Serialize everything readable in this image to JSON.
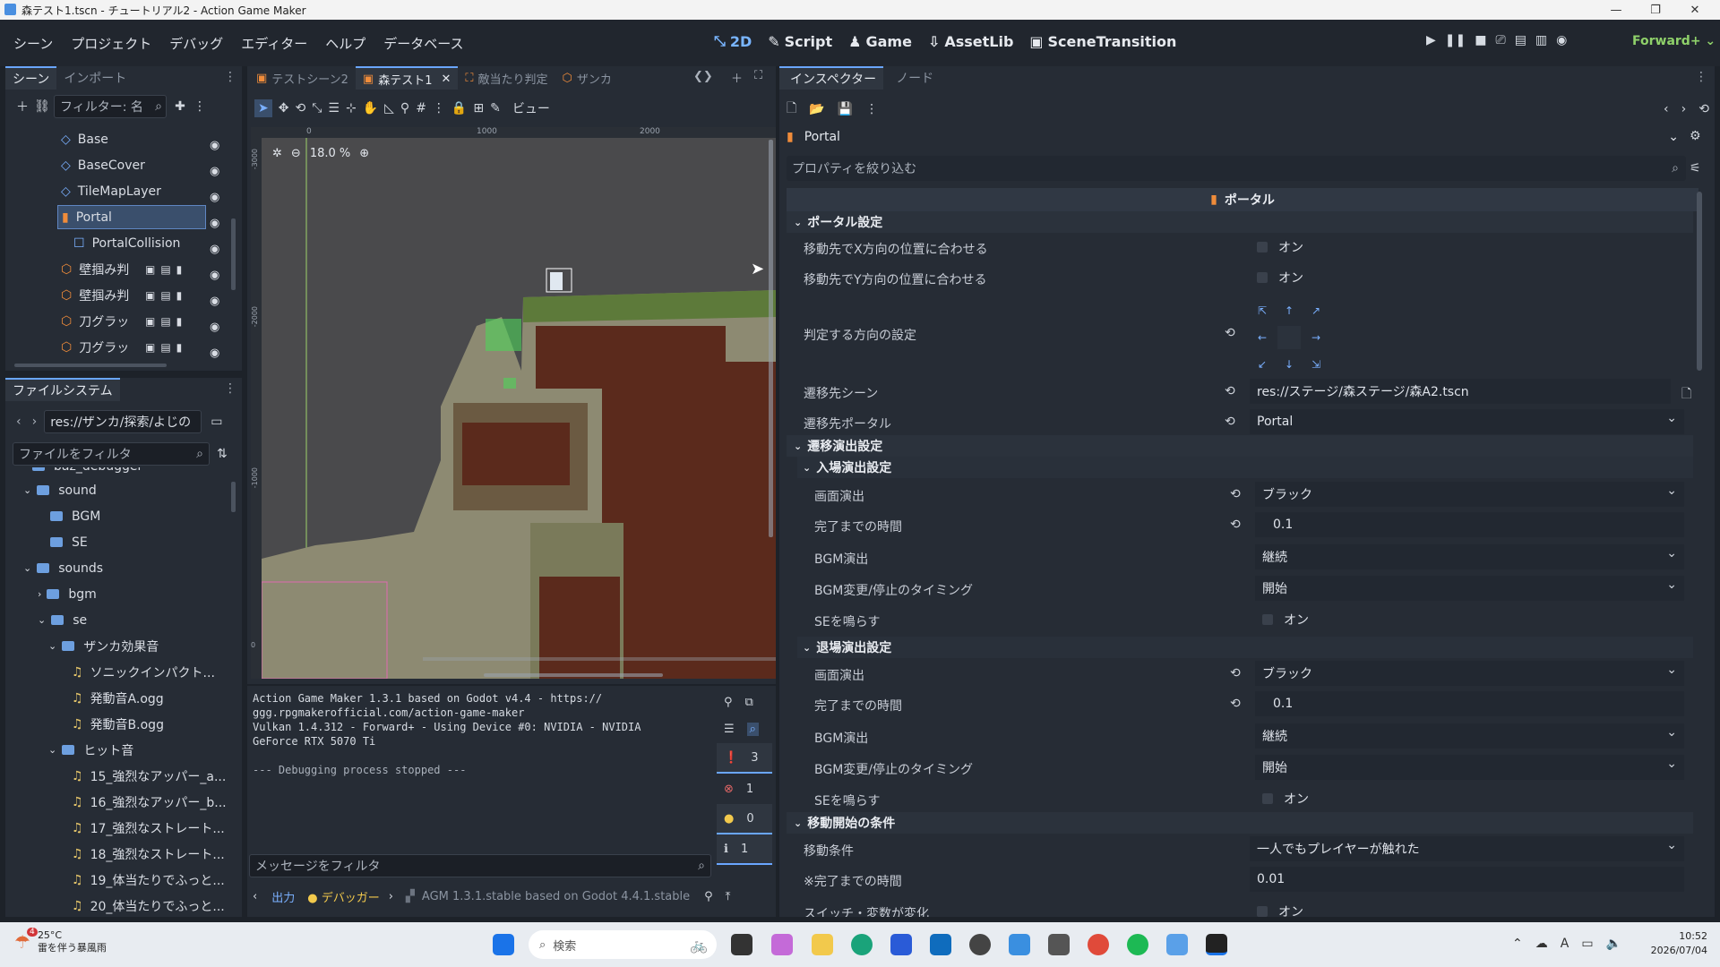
{
  "window": {
    "title": "森テスト1.tscn - チュートリアル2 - Action Game Maker"
  },
  "menu": {
    "items": [
      "シーン",
      "プロジェクト",
      "デバッグ",
      "エディター",
      "ヘルプ",
      "データベース"
    ]
  },
  "workspaces": {
    "items": [
      "2D",
      "Script",
      "Game",
      "AssetLib",
      "SceneTransition"
    ],
    "active": "2D"
  },
  "renderer": "Forward+",
  "scene_dock": {
    "tabs": [
      "シーン",
      "インポート"
    ],
    "filter_placeholder": "フィルター: 名",
    "nodes": [
      {
        "label": "Base"
      },
      {
        "label": "BaseCover"
      },
      {
        "label": "TileMapLayer"
      },
      {
        "label": "Portal"
      },
      {
        "label": "PortalCollision"
      },
      {
        "label": "壁掴み判"
      },
      {
        "label": "壁掴み判"
      },
      {
        "label": "刀グラッ"
      },
      {
        "label": "刀グラッ"
      }
    ]
  },
  "filesystem": {
    "tab": "ファイルシステム",
    "path": "res://ザンカ/探索/よじの",
    "filter_placeholder": "ファイルをフィルタ",
    "items": [
      {
        "label": "baz_debugger"
      },
      {
        "label": "sound"
      },
      {
        "label": "BGM"
      },
      {
        "label": "SE"
      },
      {
        "label": "sounds"
      },
      {
        "label": "bgm"
      },
      {
        "label": "se"
      },
      {
        "label": "ザンカ効果音"
      },
      {
        "label": "ソニックインパクト..."
      },
      {
        "label": "発動音A.ogg"
      },
      {
        "label": "発動音B.ogg"
      },
      {
        "label": "ヒット音"
      },
      {
        "label": "15_強烈なアッパー_a..."
      },
      {
        "label": "16_強烈なアッパー_b..."
      },
      {
        "label": "17_強烈なストレート..."
      },
      {
        "label": "18_強烈なストレート..."
      },
      {
        "label": "19_体当たりでふっと..."
      },
      {
        "label": "20_体当たりでふっと..."
      }
    ]
  },
  "editor_tabs": {
    "items": [
      "テストシーン2",
      "森テスト1",
      "敵当たり判定",
      "ザンカ"
    ],
    "active": "森テスト1"
  },
  "viewport": {
    "zoom": "18.0 %",
    "ruler_top": [
      "0",
      "1000",
      "2000"
    ],
    "ruler_left": [
      "-3000",
      "-2000",
      "-1000",
      "0"
    ],
    "view_label": "ビュー"
  },
  "output": {
    "lines": [
      "Action Game Maker 1.3.1 based on Godot v4.4 - https://",
      "ggg.rpgmakerofficial.com/action-game-maker",
      "Vulkan 1.4.312 - Forward+ - Using Device #0: NVIDIA - NVIDIA",
      "GeForce RTX 5070 Ti",
      "",
      "--- Debugging process stopped ---"
    ],
    "filter_placeholder": "メッセージをフィルタ",
    "counts": {
      "messages": "3",
      "errors": "1",
      "warnings": "0",
      "info": "1"
    },
    "bottom_tabs": [
      "出力",
      "デバッガー"
    ],
    "version": "AGM 1.3.1.stable based on Godot 4.4.1.stable"
  },
  "inspector": {
    "tabs": [
      "インスペクター",
      "ノード"
    ],
    "node": "Portal",
    "filter_placeholder": "プロパティを絞り込む",
    "class_name": "ポータル",
    "sections": {
      "portal": "ポータル設定",
      "transition": "遷移演出設定",
      "enter": "入場演出設定",
      "exit": "退場演出設定",
      "start": "移動開始の条件"
    },
    "props": {
      "match_x": {
        "label": "移動先でX方向の位置に合わせる",
        "value": "オン"
      },
      "match_y": {
        "label": "移動先でY方向の位置に合わせる",
        "value": "オン"
      },
      "direction": {
        "label": "判定する方向の設定"
      },
      "dest_scene": {
        "label": "遷移先シーン",
        "value": "res://ステージ/森ステージ/森A2.tscn"
      },
      "dest_portal": {
        "label": "遷移先ポータル",
        "value": "Portal"
      },
      "enter_screen": {
        "label": "画面演出",
        "value": "ブラック"
      },
      "enter_time": {
        "label": "完了までの時間",
        "value": "0.1"
      },
      "enter_bgm": {
        "label": "BGM演出",
        "value": "継続"
      },
      "enter_bgm_timing": {
        "label": "BGM変更/停止のタイミング",
        "value": "開始"
      },
      "enter_se": {
        "label": "SEを鳴らす",
        "value": "オン"
      },
      "exit_screen": {
        "label": "画面演出",
        "value": "ブラック"
      },
      "exit_time": {
        "label": "完了までの時間",
        "value": "0.1"
      },
      "exit_bgm": {
        "label": "BGM演出",
        "value": "継続"
      },
      "exit_bgm_timing": {
        "label": "BGM変更/停止のタイミング",
        "value": "開始"
      },
      "exit_se": {
        "label": "SEを鳴らす",
        "value": "オン"
      },
      "move_cond": {
        "label": "移動条件",
        "value": "一人でもプレイヤーが触れた"
      },
      "wait_time": {
        "label": "※完了までの時間",
        "value": "0.01"
      },
      "switch": {
        "label": "スイッチ・変数が変化",
        "value": "オン"
      }
    }
  },
  "taskbar": {
    "weather_temp": "25°C",
    "weather_desc": "雷を伴う暴風雨",
    "weather_badge": "4",
    "search_placeholder": "検索",
    "time": "10:52",
    "date": "2026/07/04"
  }
}
